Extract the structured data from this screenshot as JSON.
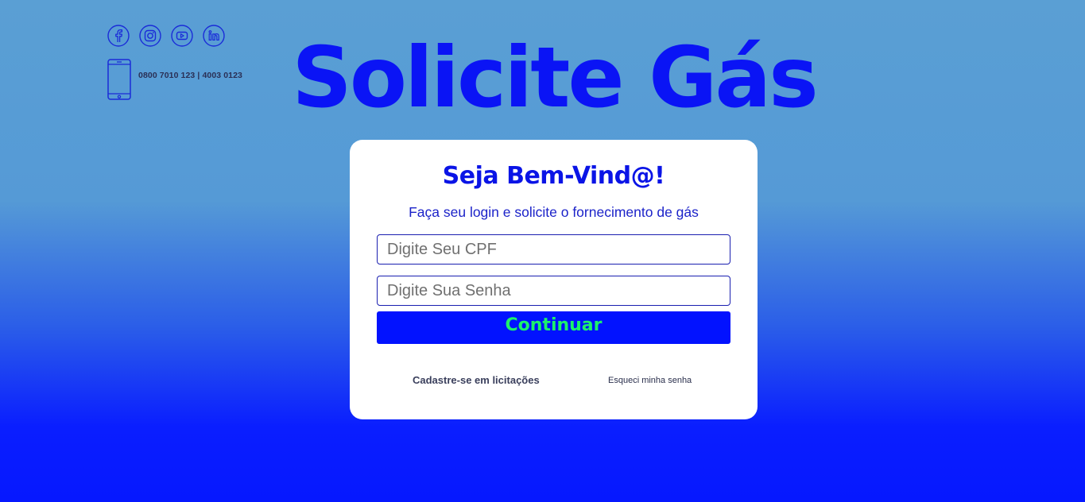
{
  "header": {
    "title": "Solicite Gás",
    "phone_numbers": "0800 7010 123 | 4003 0123",
    "social_icons": [
      "facebook-icon",
      "instagram-icon",
      "youtube-icon",
      "linkedin-icon"
    ]
  },
  "login": {
    "title": "Seja Bem-Vind@!",
    "subtitle": "Faça seu login e solicite o fornecimento de gás",
    "cpf_placeholder": "Digite Seu CPF",
    "password_placeholder": "Digite Sua Senha",
    "continue_label": "Continuar",
    "register_link": "Cadastre-se em licitações",
    "forgot_link": "Esqueci minha senha"
  },
  "colors": {
    "brand_blue": "#0a14f5",
    "button_blue": "#0212ff",
    "button_text_green": "#1cf26a",
    "bg_top": "#5a9fd4",
    "bg_bottom": "#0618ff"
  }
}
